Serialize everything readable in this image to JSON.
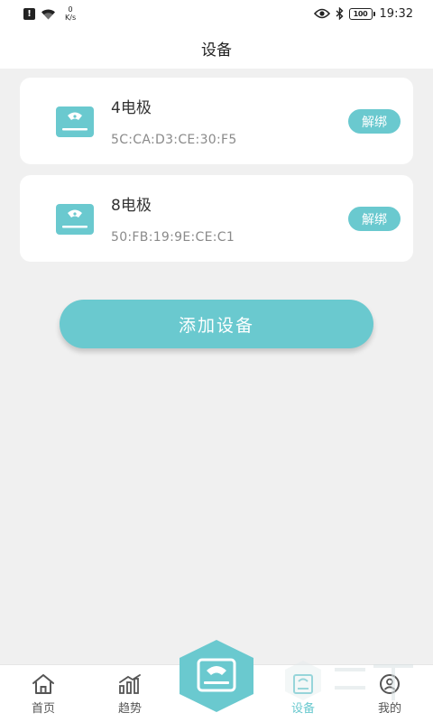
{
  "status_bar": {
    "net_speed_value": "0",
    "net_speed_unit": "K/s",
    "battery": "100",
    "time": "19:32"
  },
  "header": {
    "title": "设备"
  },
  "devices": [
    {
      "name": "4电极",
      "mac": "5C:CA:D3:CE:30:F5",
      "unbind_label": "解绑"
    },
    {
      "name": "8电极",
      "mac": "50:FB:19:9E:CE:C1",
      "unbind_label": "解绑"
    }
  ],
  "add_device_label": "添加设备",
  "tabs": [
    {
      "label": "首页",
      "icon": "home-icon",
      "active": false
    },
    {
      "label": "趋势",
      "icon": "trend-chart-icon",
      "active": false
    },
    {
      "label": "",
      "icon": "scale-icon",
      "active": false
    },
    {
      "label": "设备",
      "icon": "device-icon",
      "active": true
    },
    {
      "label": "我的",
      "icon": "profile-icon",
      "active": false
    }
  ],
  "colors": {
    "accent": "#6ac9cf",
    "background": "#f0f0f0",
    "card": "#ffffff",
    "text_primary": "#333333",
    "text_secondary": "#8a8a8a"
  }
}
